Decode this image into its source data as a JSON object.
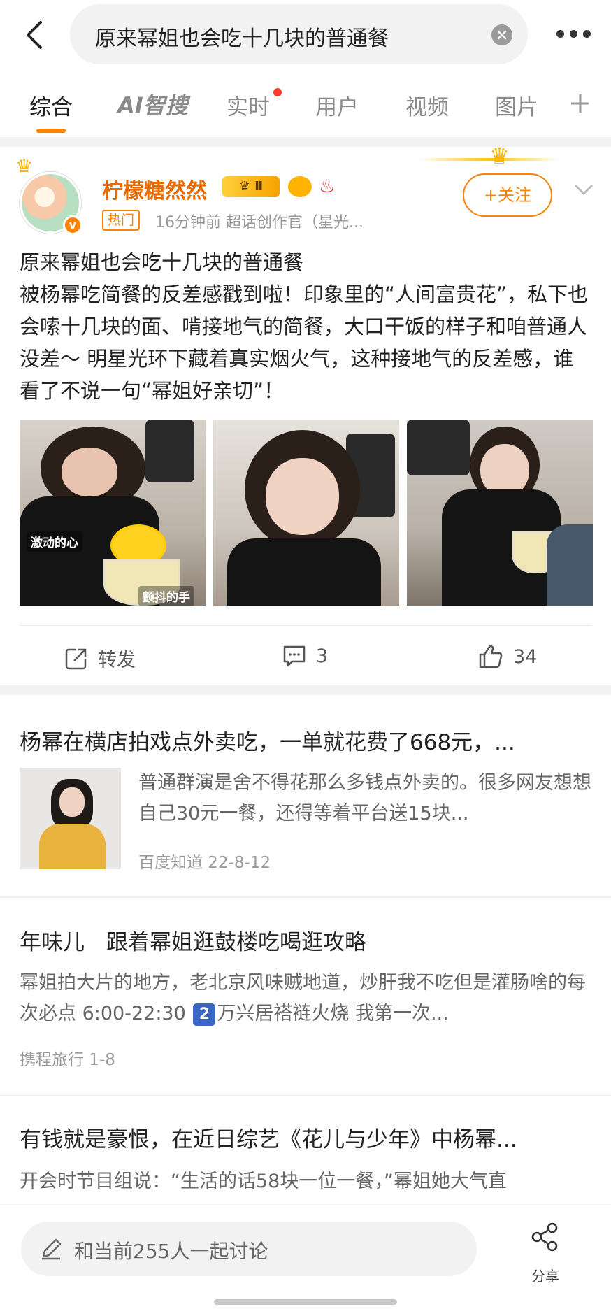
{
  "search": {
    "query": "原来幂姐也会吃十几块的普通餐"
  },
  "tabs": [
    {
      "label": "综合"
    },
    {
      "label": "AI智搜"
    },
    {
      "label": "实时"
    },
    {
      "label": "用户"
    },
    {
      "label": "视频"
    },
    {
      "label": "图片"
    }
  ],
  "post": {
    "username": "柠檬糖然然",
    "vip_level": "♛ Ⅱ",
    "hot_tag": "热门",
    "meta": "16分钟前  超话创作官（星光...",
    "follow_label": "+关注",
    "text": "原来幂姐也会吃十几块的普通餐\n被杨幂吃简餐的反差感戳到啦！印象里的“人间富贵花”，私下也会嗦十几块的面、啃接地气的简餐，大口干饭的样子和咱普通人没差～ 明星光环下藏着真实烟火气，这种接地气的反差感，谁看了不说一句“幂姐好亲切”！",
    "image_captions": [
      "激动的心",
      "颤抖的手"
    ],
    "actions": {
      "repost_label": "转发",
      "comment_count": "3",
      "like_count": "34"
    }
  },
  "articles": [
    {
      "title": "杨幂在横店拍戏点外卖吃，一单就花费了668元，...",
      "desc": "普通群演是舍不得花那么多钱点外卖的。很多网友想想自己30元一餐，还得等着平台送15块...",
      "source": "百度知道 22-8-12"
    },
    {
      "title": "年味儿　跟着幂姐逛鼓楼吃喝逛攻略",
      "desc_before": "幂姐拍大片的地方，老北京风味贼地道，炒肝我不吃但是灌肠啥的每次必点 6:00-22:30 ",
      "desc_badge": "2",
      "desc_after": "万兴居褡裢火烧 我第一次...",
      "source": "携程旅行 1-8"
    },
    {
      "title": "有钱就是豪恨，在近日综艺《花儿与少年》中杨幂...",
      "desc": "开会时节目组说：“生活的话58块一位一餐，”幂姐她大气直"
    }
  ],
  "bottom": {
    "comment_placeholder": "和当前255人一起讨论",
    "share_label": "分享"
  },
  "colors": {
    "accent": "#ff8200",
    "hot_dot": "#ff3b30",
    "text": "#222222",
    "muted": "#9a9a9a"
  }
}
